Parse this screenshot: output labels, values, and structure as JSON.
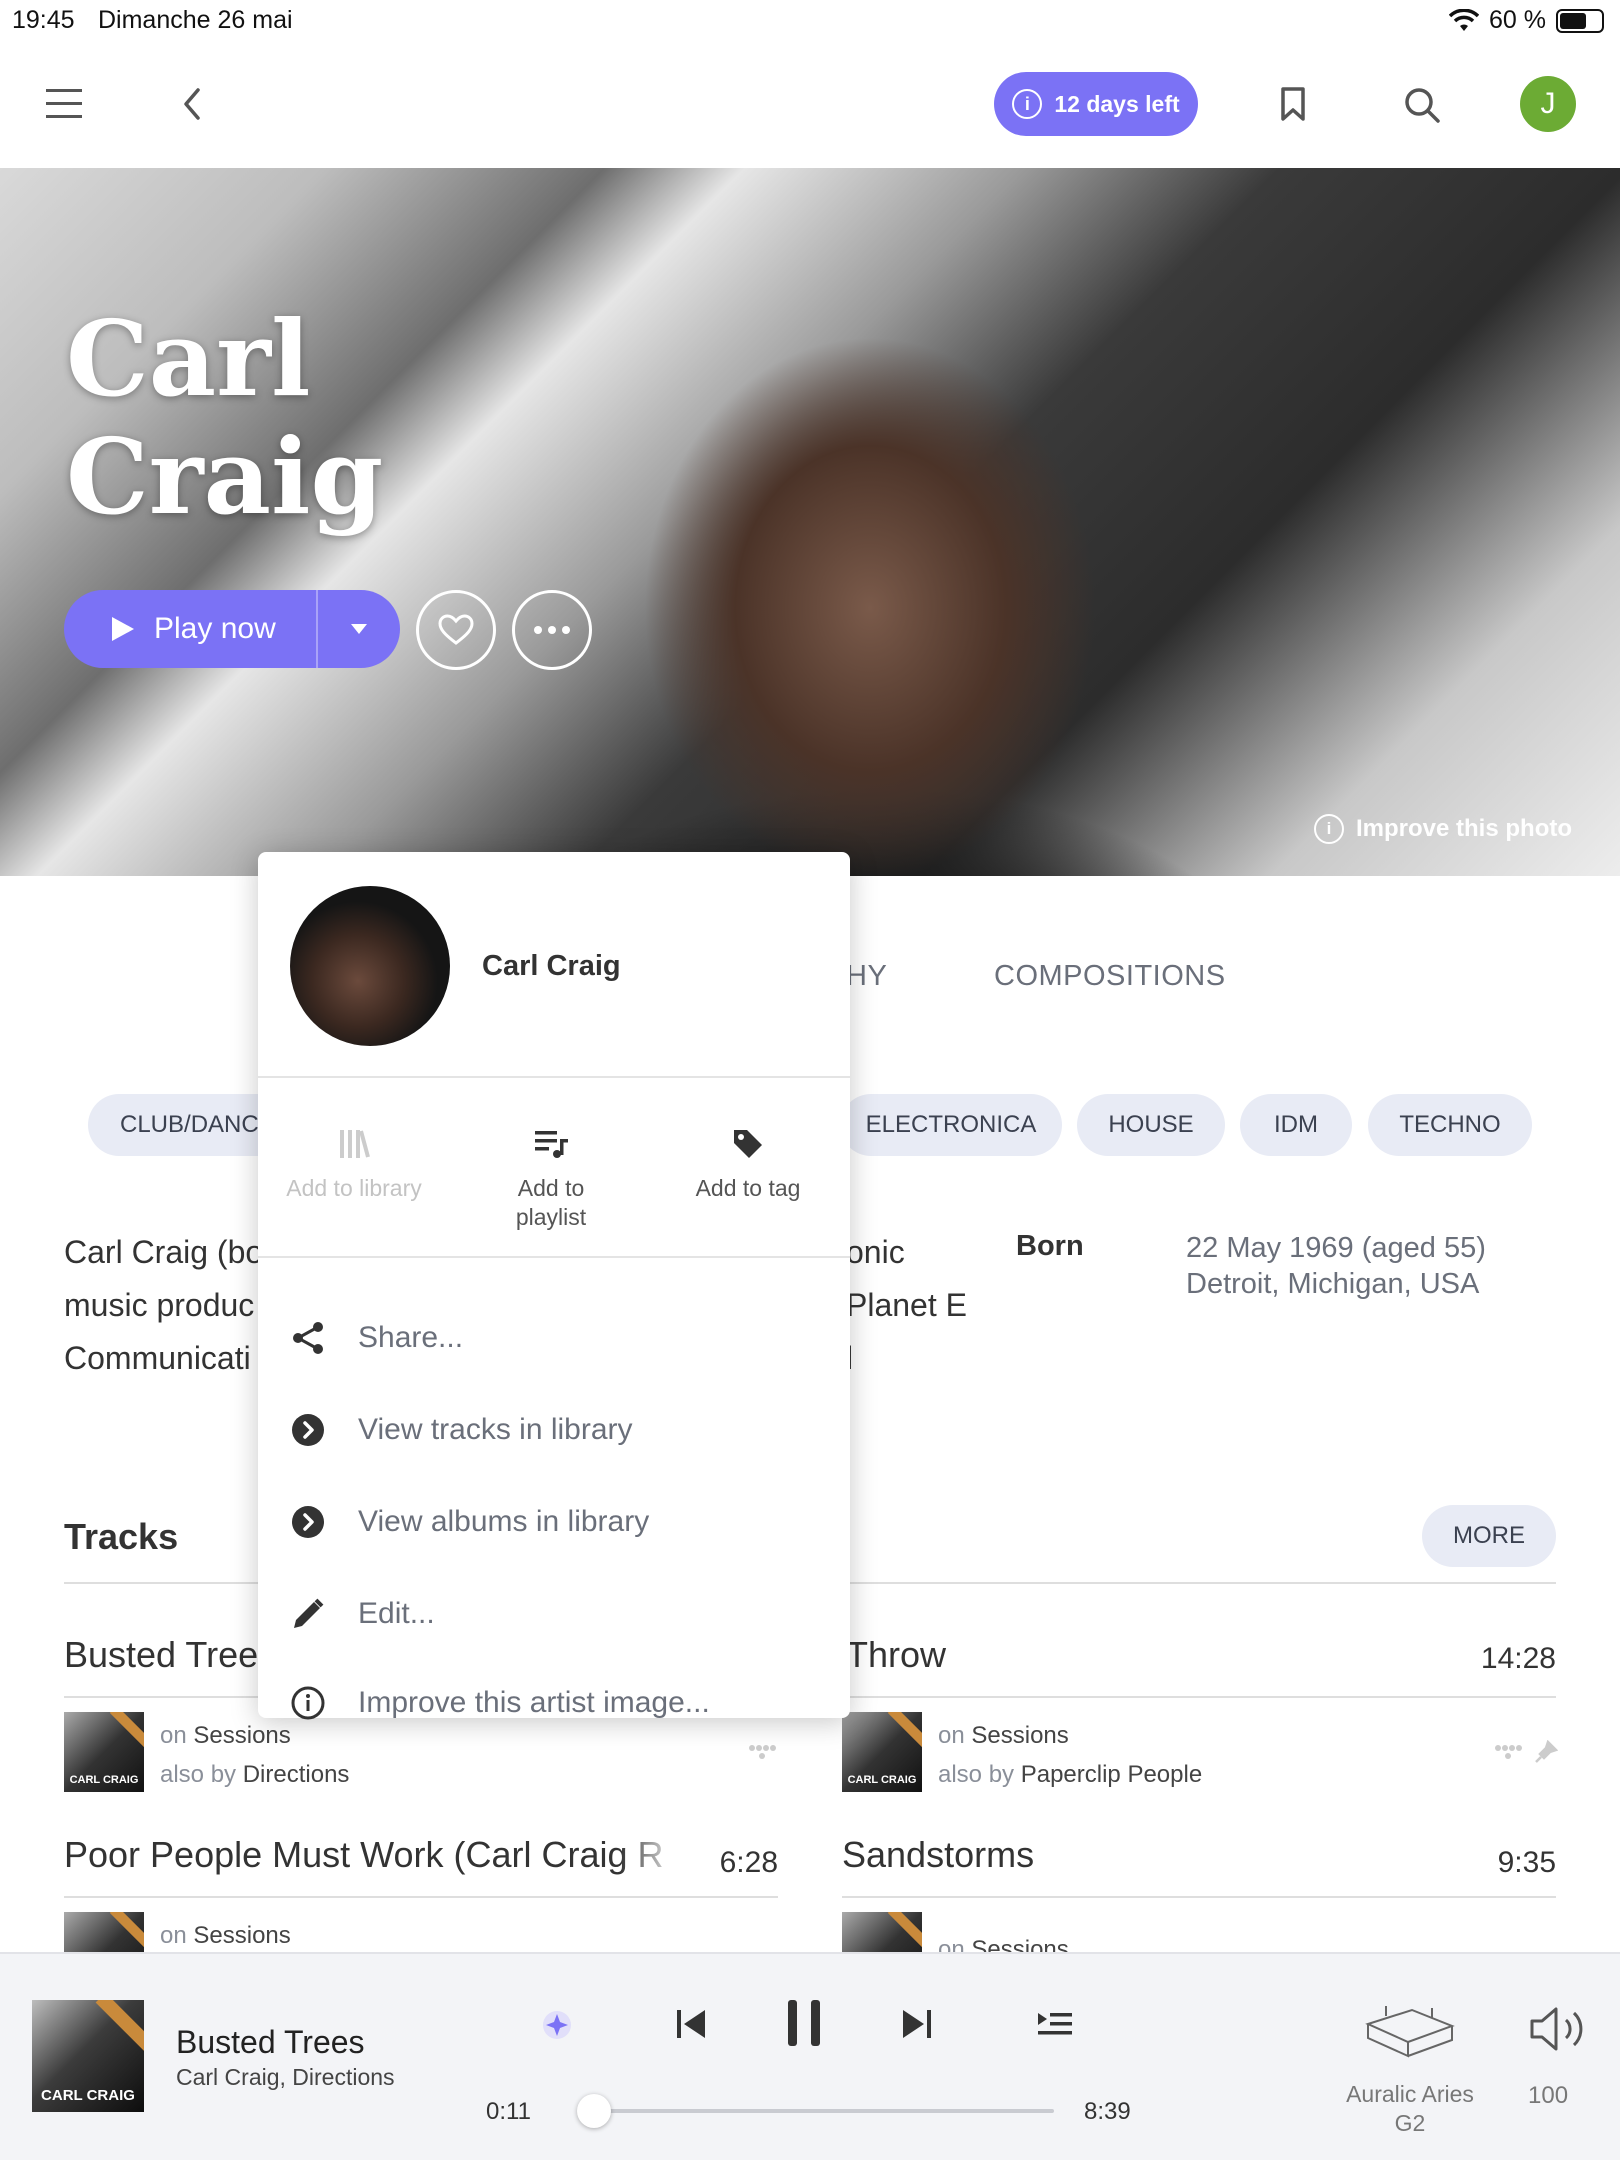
{
  "status_bar": {
    "time": "19:45",
    "date": "Dimanche 26 mai",
    "battery": "60 %"
  },
  "nav": {
    "trial_badge": "12 days left"
  },
  "user": {
    "initial": "J",
    "avatar_color": "#6cab34"
  },
  "accent_color": "#7b72f5",
  "artist": {
    "name_line1": "Carl",
    "name_line2": "Craig",
    "play_label": "Play now",
    "improve_photo": "Improve this photo"
  },
  "tabs": {
    "partial_left": "HY",
    "compositions": "COMPOSITIONS"
  },
  "genres": {
    "club": "CLUB/DANC",
    "electronica": "ELECTRONICA",
    "house": "HOUSE",
    "idm": "IDM",
    "techno": "TECHNO"
  },
  "bio": {
    "line1": "Carl Craig (bo",
    "line2": "music produc",
    "line3": "Communicati",
    "right1": "onic",
    "right2": "Planet E",
    "right3": "l"
  },
  "born": {
    "label": "Born",
    "date": "22 May 1969 (aged 55)",
    "place": "Detroit, Michigan, USA"
  },
  "tracks_section": {
    "title": "Tracks",
    "more": "MORE",
    "items": [
      {
        "title": "Busted Tree",
        "on_label": "on",
        "album": "Sessions",
        "also_label": "also by",
        "also": "Directions",
        "thumb": "CARL CRAIG"
      },
      {
        "title": "Throw",
        "time": "14:28",
        "on_label": "on",
        "album": "Sessions",
        "also_label": "also by",
        "also": "Paperclip People",
        "thumb": "CARL CRAIG"
      },
      {
        "title": "Poor People Must Work (Carl Craig R",
        "time": "6:28",
        "on_label": "on",
        "album": "Sessions"
      },
      {
        "title": "Sandstorms",
        "time": "9:35",
        "on_label": "on",
        "album": "Sessions"
      }
    ]
  },
  "popup": {
    "artist_name": "Carl Craig",
    "actions": {
      "add_library": "Add to library",
      "add_playlist_1": "Add to",
      "add_playlist_2": "playlist",
      "add_tag": "Add to tag"
    },
    "items": {
      "share": "Share...",
      "view_tracks": "View tracks in library",
      "view_albums": "View albums in library",
      "edit": "Edit...",
      "improve_image": "Improve this artist image..."
    }
  },
  "player": {
    "track_title": "Busted Trees",
    "track_artist": "Carl Craig, Directions",
    "thumb_label": "CARL CRAIG",
    "elapsed": "0:11",
    "duration": "8:39",
    "progress_fraction": 0.021,
    "device_line1": "Auralic Aries",
    "device_line2": "G2",
    "volume": "100"
  }
}
